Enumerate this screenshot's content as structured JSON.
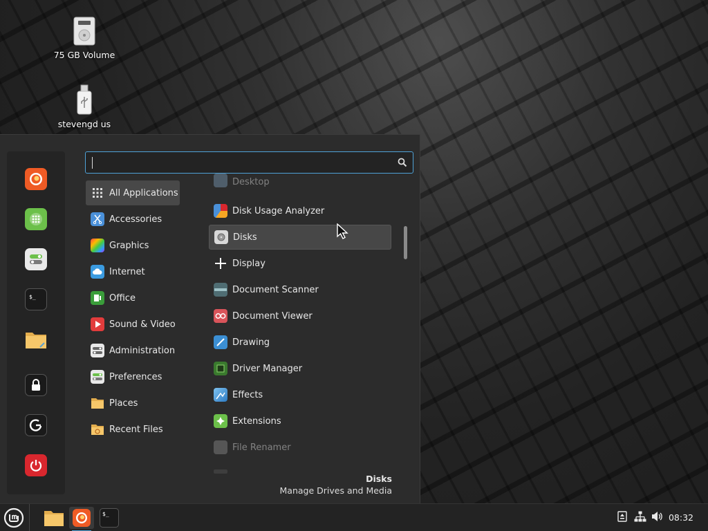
{
  "desktop": {
    "icons": [
      {
        "label": "75 GB Volume",
        "icon": "drive-icon"
      },
      {
        "label": "stevengd us",
        "icon": "usb-drive-icon"
      }
    ]
  },
  "menu": {
    "search": {
      "value": "",
      "placeholder": ""
    },
    "favorites": [
      {
        "name": "firefox-icon",
        "color": "#ef5b25"
      },
      {
        "name": "software-manager-icon",
        "color": "#6cc04a"
      },
      {
        "name": "settings-toggle-icon",
        "color": "#e9e9e9"
      },
      {
        "name": "terminal-icon",
        "color": "#1a1a1a"
      },
      {
        "name": "folder-icon",
        "color": "#f6c76a"
      },
      {
        "name": "lock-icon",
        "color": "#1a1a1a"
      },
      {
        "name": "logout-icon",
        "color": "#1a1a1a"
      },
      {
        "name": "power-icon",
        "color": "#d9272e"
      }
    ],
    "categories": [
      {
        "label": "All Applications",
        "active": true
      },
      {
        "label": "Accessories"
      },
      {
        "label": "Graphics"
      },
      {
        "label": "Internet"
      },
      {
        "label": "Office"
      },
      {
        "label": "Sound & Video"
      },
      {
        "label": "Administration"
      },
      {
        "label": "Preferences"
      },
      {
        "label": "Places"
      },
      {
        "label": "Recent Files"
      }
    ],
    "apps": [
      {
        "label": "Desktop"
      },
      {
        "label": "Disk Usage Analyzer"
      },
      {
        "label": "Disks",
        "hovered": true
      },
      {
        "label": "Display"
      },
      {
        "label": "Document Scanner"
      },
      {
        "label": "Document Viewer"
      },
      {
        "label": "Drawing"
      },
      {
        "label": "Driver Manager"
      },
      {
        "label": "Effects"
      },
      {
        "label": "Extensions"
      },
      {
        "label": "File Renamer"
      }
    ],
    "description": {
      "title": "Disks",
      "subtitle": "Manage Drives and Media"
    }
  },
  "panel": {
    "clock": "08:32",
    "launchers": [
      "menu-icon",
      "files-icon",
      "firefox-icon",
      "terminal-icon"
    ],
    "tray": [
      "update-manager-icon",
      "network-icon",
      "volume-icon"
    ]
  },
  "colors": {
    "accent": "#4fa3d9",
    "menu_bg": "#2c2c2c",
    "panel_bg": "#232323"
  }
}
